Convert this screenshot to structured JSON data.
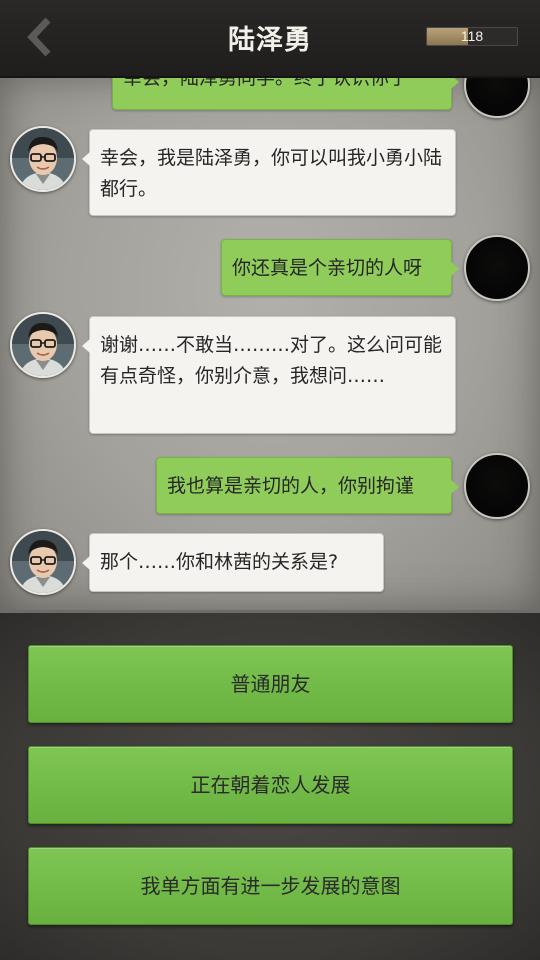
{
  "header": {
    "title": "陆泽勇",
    "meter_value": "118",
    "meter_fill_fraction": 0.45,
    "back_icon": "chevron-left-icon"
  },
  "messages": [
    {
      "side": "right",
      "text": "幸会，陆泽勇同学。终于认识你了"
    },
    {
      "side": "left",
      "text": "幸会，我是陆泽勇，你可以叫我小勇小陆都行。"
    },
    {
      "side": "right",
      "text": "你还真是个亲切的人呀"
    },
    {
      "side": "left",
      "text": "谢谢……不敢当………对了。这么问可能有点奇怪，你别介意，我想问……"
    },
    {
      "side": "right",
      "text": "我也算是亲切的人，你别拘谨"
    },
    {
      "side": "left",
      "text": "那个……你和林茜的关系是?"
    }
  ],
  "choices": [
    {
      "label": "普通朋友"
    },
    {
      "label": "正在朝着恋人发展"
    },
    {
      "label": "我单方面有进一步发展的意图"
    }
  ],
  "colors": {
    "player_bubble": "#8fcc5a",
    "npc_bubble": "#f4f3f0",
    "choice_button": "#74bc48",
    "header_bg": "#242322"
  }
}
